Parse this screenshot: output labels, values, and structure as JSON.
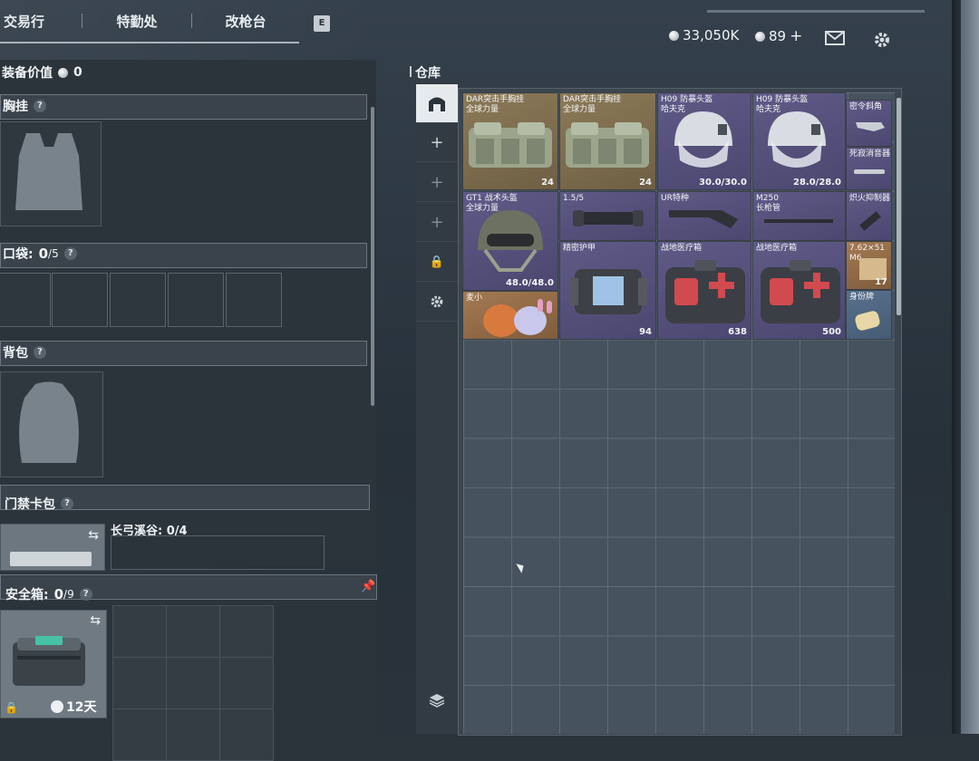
{
  "nav": {
    "tabs": [
      "交易行",
      "特勤处",
      "改枪台"
    ],
    "key_hint": "E"
  },
  "currency": {
    "coins": "33,050K",
    "premium": "89",
    "premium_add": "+"
  },
  "loadout": {
    "equipment_value_label": "装备价值",
    "equipment_value": "0",
    "chest_rig_label": "胸挂",
    "pockets_label": "口袋:",
    "pockets_count": "0",
    "pockets_cap": "/5",
    "backpack_label": "背包",
    "keycard_label": "门禁卡包",
    "keycard_area_label": "长弓溪谷: 0/4",
    "safe_label": "安全箱:",
    "safe_count": "0",
    "safe_cap": "/9",
    "safe_timer": "12天"
  },
  "warehouse": {
    "title": "仓库",
    "items": [
      {
        "name": "DAR突击手胸挂",
        "sub": "全球力量",
        "qty": "24"
      },
      {
        "name": "DAR突击手胸挂",
        "sub": "全球力量",
        "qty": "24"
      },
      {
        "name": "H09 防暴头盔",
        "sub": "哈夫克",
        "qty": "30.0/30.0"
      },
      {
        "name": "H09 防暴头盔",
        "sub": "哈夫克",
        "qty": "28.0/28.0"
      },
      {
        "name": "密令斜角",
        "sub": "",
        "qty": ""
      },
      {
        "name": "死寂消音器",
        "sub": "",
        "qty": ""
      },
      {
        "name": "GT1 战术头盔",
        "sub": "全球力量",
        "qty": "48.0/48.0"
      },
      {
        "name": "1.5/5",
        "sub": "",
        "qty": ""
      },
      {
        "name": "UR特种",
        "sub": "",
        "qty": ""
      },
      {
        "name": "M250",
        "sub": "长枪管",
        "qty": ""
      },
      {
        "name": "炽火抑制器",
        "sub": "",
        "qty": ""
      },
      {
        "name": "精密护甲",
        "sub": "",
        "qty": "94"
      },
      {
        "name": "战地医疗箱",
        "sub": "",
        "qty": "638"
      },
      {
        "name": "战地医疗箱",
        "sub": "",
        "qty": "500"
      },
      {
        "name": "7.62×51",
        "sub": "M6",
        "qty": "17"
      },
      {
        "name": "麦小",
        "sub": "",
        "qty": ""
      },
      {
        "name": "身份牌",
        "sub": "",
        "qty": ""
      }
    ]
  },
  "colors": {
    "gold": "#8c7a58",
    "purple": "#5f5a86",
    "blue": "#59718d",
    "orange": "#a47a52"
  }
}
